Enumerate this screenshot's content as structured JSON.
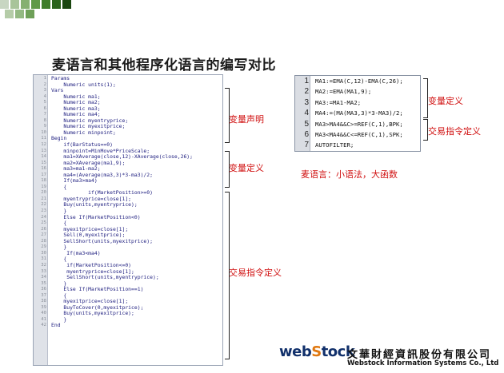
{
  "title": "麦语言和其他程序化语言的编写对比",
  "colors": {
    "deco": [
      "#c8d6c2",
      "#9bbf8c",
      "#6ea058",
      "#3e7c2b",
      "#255d19",
      "#1a4410",
      "#123808"
    ]
  },
  "code_lines": [
    {
      "n": "1",
      "t": "Params"
    },
    {
      "n": "2",
      "t": "    Numeric units(1);"
    },
    {
      "n": "3",
      "t": "Vars"
    },
    {
      "n": "4",
      "t": "    Numeric ma1;"
    },
    {
      "n": "5",
      "t": "    Numeric ma2;"
    },
    {
      "n": "6",
      "t": "    Numeric ma3;"
    },
    {
      "n": "7",
      "t": "    Numeric ma4;"
    },
    {
      "n": "8",
      "t": "    Numeric myentryprice;"
    },
    {
      "n": "9",
      "t": "    Numeric myexitprice;"
    },
    {
      "n": "10",
      "t": "    Numeric minpoint;"
    },
    {
      "n": "11",
      "t": "Begin"
    },
    {
      "n": "12",
      "t": "    if(BarStatus==0)"
    },
    {
      "n": "13",
      "t": "    minpoint=MinMove*PriceScale;"
    },
    {
      "n": "14",
      "t": "    ma1=XAverage(close,12)-XAverage(close,26);"
    },
    {
      "n": "15",
      "t": "    ma2=XAverage(ma1,9);"
    },
    {
      "n": "16",
      "t": "    ma3=ma1-ma2;"
    },
    {
      "n": "17",
      "t": "    ma4=(Average(ma3,3)*3-ma3)/2;"
    },
    {
      "n": "18",
      "t": "    If(ma3>ma4)"
    },
    {
      "n": "19",
      "t": "    {"
    },
    {
      "n": "20",
      "t": "            if(MarketPosition>=0)"
    },
    {
      "n": "21",
      "t": "    myentryprice=close[1];"
    },
    {
      "n": "22",
      "t": "    Buy(units,myentryprice);"
    },
    {
      "n": "23",
      "t": "    }"
    },
    {
      "n": "24",
      "t": "    Else If(MarketPosition<0)"
    },
    {
      "n": "25",
      "t": "    {"
    },
    {
      "n": "26",
      "t": "    myexitprice=close[1];"
    },
    {
      "n": "27",
      "t": "    Sell(0,myexitprice);"
    },
    {
      "n": "28",
      "t": "    SellShort(units,myexitprice);"
    },
    {
      "n": "29",
      "t": "    }"
    },
    {
      "n": "30",
      "t": "     If(ma3<ma4)"
    },
    {
      "n": "31",
      "t": "    {"
    },
    {
      "n": "32",
      "t": "     if(MarketPosition<=0)"
    },
    {
      "n": "33",
      "t": "     myentryprice=close[1];"
    },
    {
      "n": "34",
      "t": "     SellShort(units,myentryprice);"
    },
    {
      "n": "35",
      "t": "    }"
    },
    {
      "n": "36",
      "t": "    Else If(MarketPosition==1)"
    },
    {
      "n": "37",
      "t": "    {"
    },
    {
      "n": "38",
      "t": "    myexitprice=close[1];"
    },
    {
      "n": "39",
      "t": "    BuyToCover(0,myexitprice);"
    },
    {
      "n": "40",
      "t": "    Buy(units,myexitprice);"
    },
    {
      "n": "41",
      "t": "    }"
    },
    {
      "n": "42",
      "t": "End"
    }
  ],
  "labels": {
    "var_declare": "变量声明",
    "var_define": "变量定义",
    "trade_define": "交易指令定义",
    "ea_var_define": "变量定义",
    "ea_trade_define": "交易指令定义"
  },
  "ea_lines": [
    {
      "n": "1",
      "t": "MA1:=EMA(C,12)-EMA(C,26);"
    },
    {
      "n": "2",
      "t": "MA2:=EMA(MA1,9);"
    },
    {
      "n": "3",
      "t": "MA3:=MA1-MA2;"
    },
    {
      "n": "4",
      "t": "MA4:=(MA(MA3,3)*3-MA3)/2;"
    },
    {
      "n": "5",
      "t": "MA3>MA4&&C>=REF(C,1),BPK;"
    },
    {
      "n": "6",
      "t": "MA3<MA4&&C<=REF(C,1),SPK;"
    },
    {
      "n": "7",
      "t": "AUTOFILTER;"
    }
  ],
  "summary": "麦语言：小语法，大函数",
  "logo": {
    "web": "web",
    "s": "S",
    "tock": "tock"
  },
  "company": {
    "cn": "文華財經資訊股份有限公司",
    "en": "Webstock Information Systems Co., Ltd"
  }
}
